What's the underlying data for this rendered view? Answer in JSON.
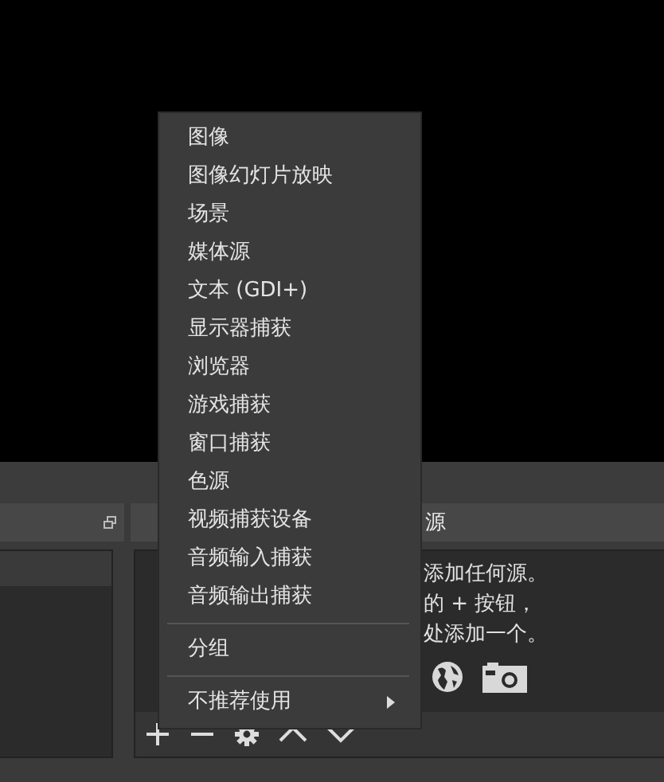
{
  "sources_dock": {
    "title": "源",
    "hint_lines": [
      "添加任何源。",
      "的 + 按钮，",
      "处添加一个。"
    ]
  },
  "context_menu": {
    "items": [
      {
        "kind": "item",
        "label": "图像"
      },
      {
        "kind": "item",
        "label": "图像幻灯片放映"
      },
      {
        "kind": "item",
        "label": "场景"
      },
      {
        "kind": "item",
        "label": "媒体源"
      },
      {
        "kind": "item",
        "label": "文本 (GDI+)"
      },
      {
        "kind": "item",
        "label": "显示器捕获"
      },
      {
        "kind": "item",
        "label": "浏览器"
      },
      {
        "kind": "item",
        "label": "游戏捕获"
      },
      {
        "kind": "item",
        "label": "窗口捕获"
      },
      {
        "kind": "item",
        "label": "色源"
      },
      {
        "kind": "item",
        "label": "视频捕获设备"
      },
      {
        "kind": "item",
        "label": "音频输入捕获"
      },
      {
        "kind": "item",
        "label": "音频输出捕获"
      },
      {
        "kind": "separator"
      },
      {
        "kind": "item",
        "label": "分组"
      },
      {
        "kind": "separator"
      },
      {
        "kind": "submenu",
        "label": "不推荐使用"
      }
    ]
  }
}
